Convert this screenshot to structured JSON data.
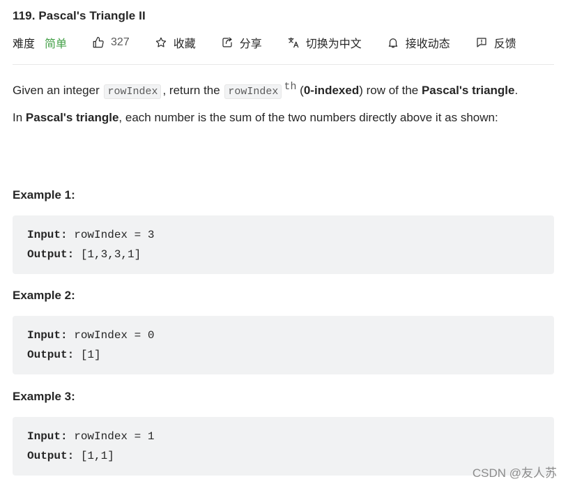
{
  "problem": {
    "title": "119. Pascal's Triangle II"
  },
  "meta": {
    "difficulty_label": "难度",
    "difficulty_value": "简单",
    "likes": "327",
    "favorite_label": "收藏",
    "share_label": "分享",
    "translate_label": "切换为中文",
    "notify_label": "接收动态",
    "feedback_label": "反馈",
    "icons": [
      "thumbs-up-icon",
      "star-icon",
      "share-icon",
      "translate-icon",
      "bell-icon",
      "feedback-icon"
    ],
    "difficulty_color": "#43a047"
  },
  "description": {
    "p1_given": "Given an integer ",
    "p1_code1": "rowIndex",
    "p1_return": ", return the ",
    "p1_code2": "rowIndex",
    "p1_sup": "th",
    "p1_open": " (",
    "p1_bold1": "0-indexed",
    "p1_mid": ") row of the ",
    "p1_bold2": "Pascal's triangle",
    "p1_end": ".",
    "p2_in": "In ",
    "p2_bold": "Pascal's triangle",
    "p2_rest": ", each number is the sum of the two numbers directly above it as shown:"
  },
  "examples": [
    {
      "title": "Example 1:",
      "input_label": "Input:",
      "input_value": " rowIndex = 3",
      "output_label": "Output:",
      "output_value": " [1,3,3,1]"
    },
    {
      "title": "Example 2:",
      "input_label": "Input:",
      "input_value": " rowIndex = 0",
      "output_label": "Output:",
      "output_value": " [1]"
    },
    {
      "title": "Example 3:",
      "input_label": "Input:",
      "input_value": " rowIndex = 1",
      "output_label": "Output:",
      "output_value": " [1,1]"
    }
  ],
  "watermark": "CSDN @友人苏"
}
